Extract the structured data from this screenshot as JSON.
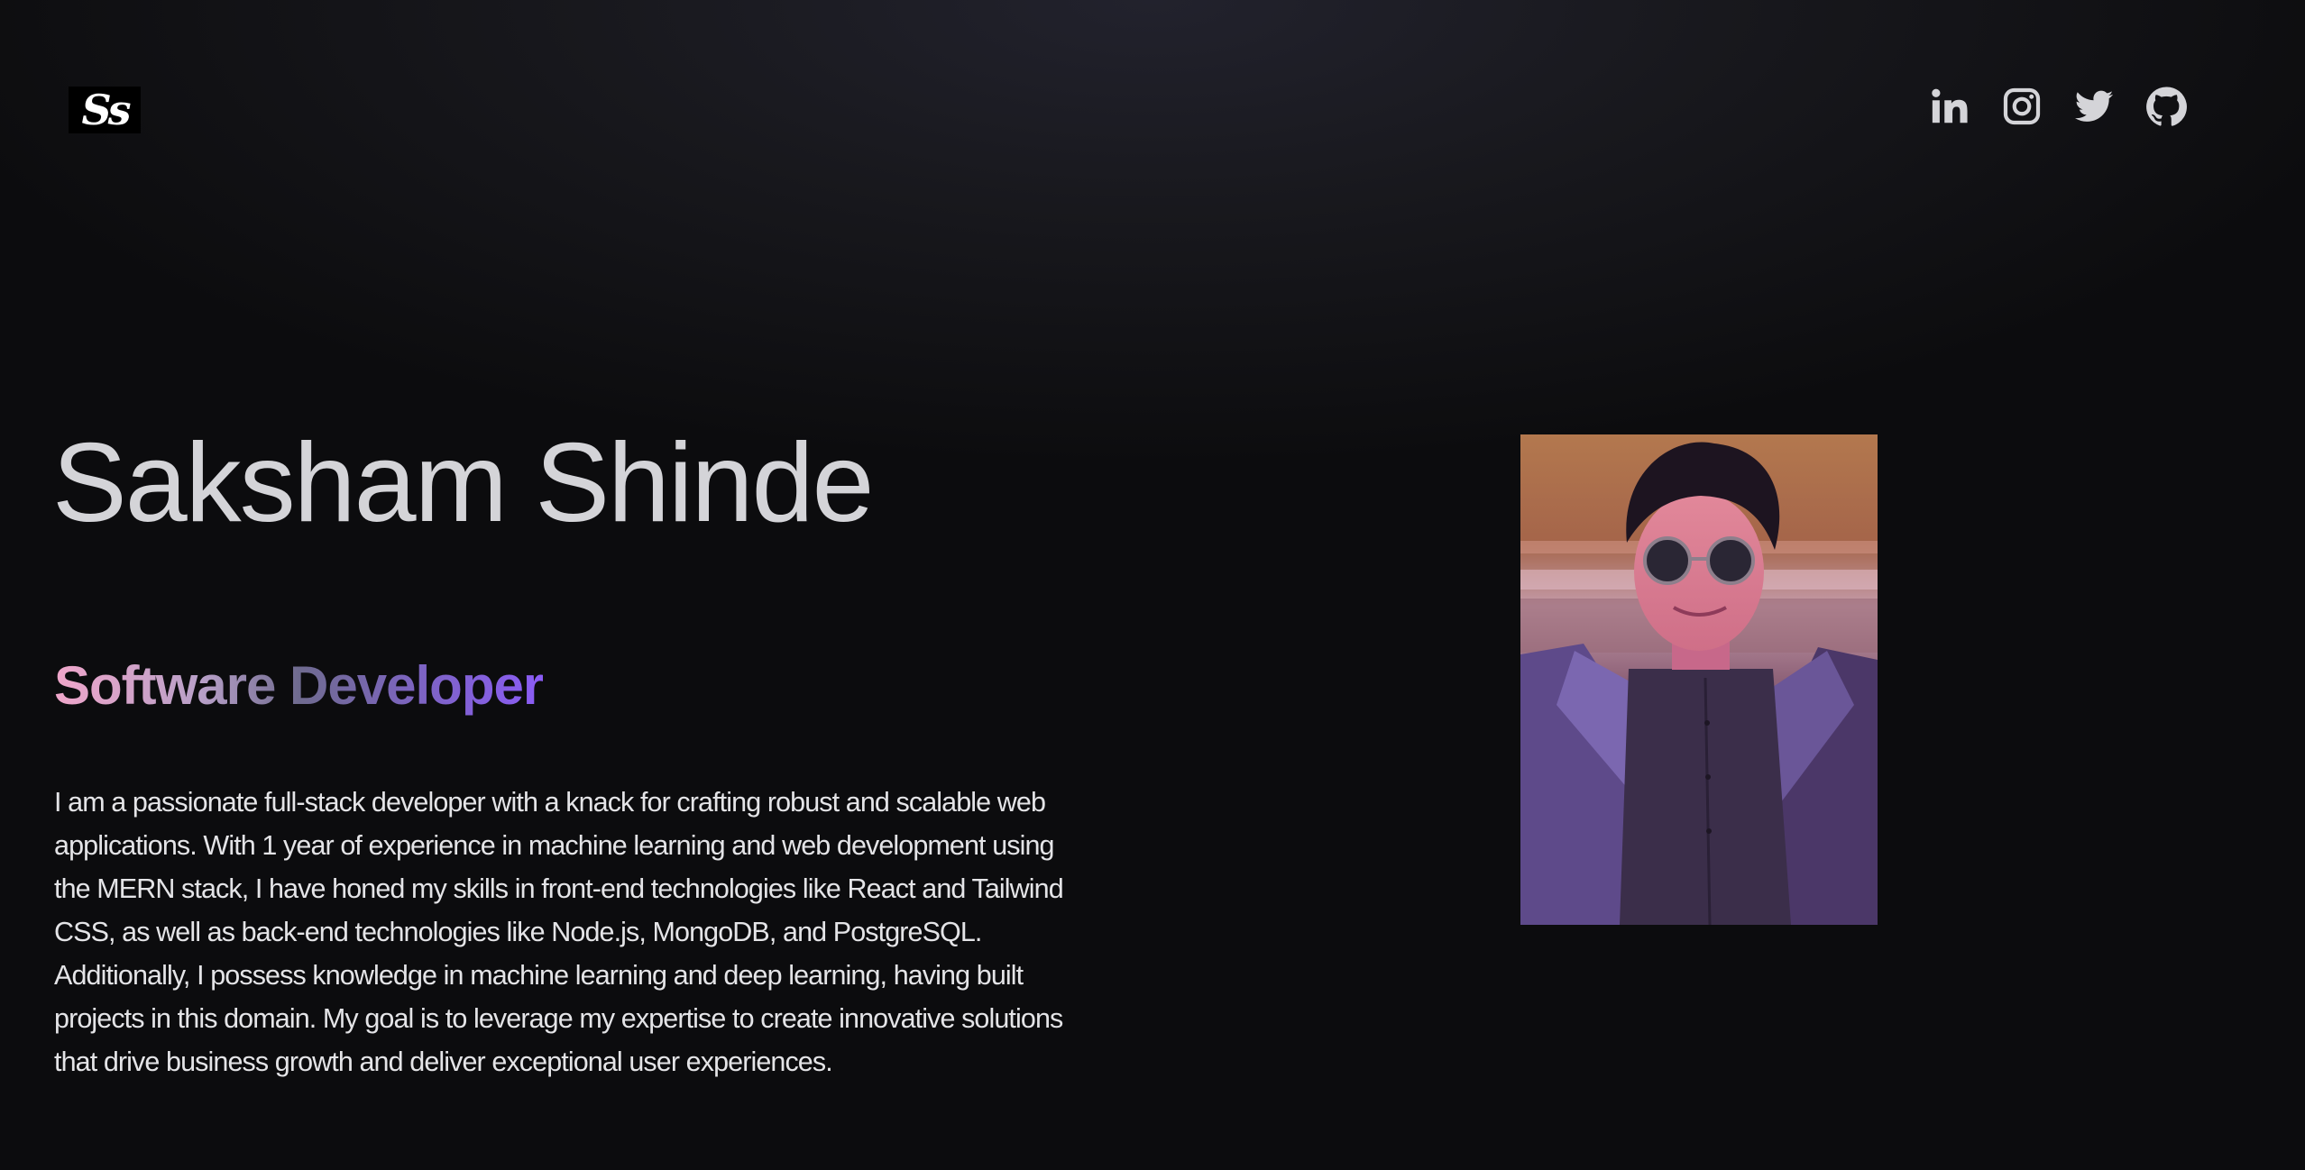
{
  "header": {
    "logo_text": "Ss",
    "socials": [
      {
        "name": "linkedin",
        "icon": "linkedin-icon"
      },
      {
        "name": "instagram",
        "icon": "instagram-icon"
      },
      {
        "name": "twitter",
        "icon": "twitter-icon"
      },
      {
        "name": "github",
        "icon": "github-icon"
      }
    ]
  },
  "hero": {
    "name": "Saksham Shinde",
    "role": "Software Developer",
    "bio": "I am a passionate full-stack developer with a knack for crafting robust and scalable web applications. With 1 year of experience in machine learning and web development using the MERN stack, I have honed my skills in front-end technologies like React and Tailwind CSS, as well as back-end technologies like Node.js, MongoDB, and PostgreSQL. Additionally, I possess knowledge in machine learning and deep learning, having built projects in this domain. My goal is to leverage my expertise to create innovative solutions that drive business growth and deliver exceptional user experiences."
  },
  "colors": {
    "background": "#0c0c0e",
    "text": "#d4d4d8",
    "role_gradient_start": "#f0a6ca",
    "role_gradient_end": "#8b5cf6"
  }
}
